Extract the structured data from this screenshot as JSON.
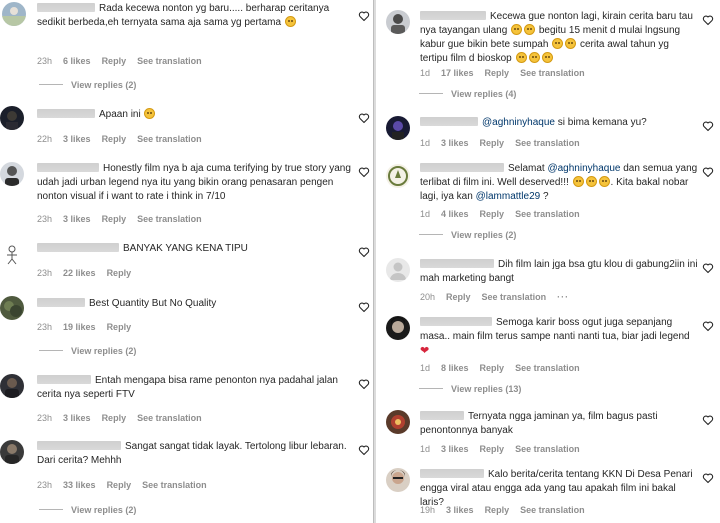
{
  "ui": {
    "reply_label": "Reply",
    "translate_label": "See translation",
    "more_label": "···"
  },
  "left": [
    {
      "name_frag": "...may_tadrat",
      "text": "Rada kecewa nonton yg baru..... berharap ceritanya sedikit berbeda,eh ternyata sama aja sama yg pertama",
      "emoji_end": 1,
      "time": "23h",
      "likes": "6 likes",
      "replies": "View replies (2)"
    },
    {
      "text": "Apaan ini",
      "emoji_end": 1,
      "time": "22h",
      "likes": "3 likes"
    },
    {
      "name_frag": "___",
      "text": "Honestly film nya b aja cuma terifying by true story yang udah jadi urban legend nya itu yang bikin orang penasaran pengen nonton visual if i want to rate i think in 7/10",
      "time": "23h",
      "likes": "3 likes"
    },
    {
      "name_frag": "25",
      "text": "BANYAK YANG KENA TIPU",
      "time": "23h",
      "likes": "22 likes"
    },
    {
      "name_frag": "_",
      "text": "Best Quantity But No Quality",
      "time": "23h",
      "likes": "19 likes",
      "replies": "View replies (2)"
    },
    {
      "text": "Entah mengapa bisa rame penonton nya padahal jalan cerita nya seperti FTV",
      "time": "23h",
      "likes": "3 likes"
    },
    {
      "text": "Sangat sangat tidak layak. Tertolong libur lebaran. Dari cerita? Mehhh",
      "time": "23h",
      "likes": "33 likes",
      "replies": "View replies (2)"
    }
  ],
  "right": [
    {
      "text": "Kecewa gue nonton lagi, kirain cerita baru tau nya tayangan ulang",
      "text2": "begitu 15 menit d mulai lngsung kabur gue bikin bete sumpah",
      "text3": "cerita awal tahun yg tertipu film d bioskop",
      "time": "1d",
      "likes": "17 likes",
      "replies": "View replies (4)"
    },
    {
      "mention": "@aghninyhaque",
      "text": "si bima kemana yu?",
      "time": "1d",
      "likes": "3 likes"
    },
    {
      "text": "Selamat",
      "mention": "@aghninyhaque",
      "text2": "dan semua yang terlibat di film ini. Well deserved!!!",
      "text3": ". Kita bakal nobar lagi, iya kan",
      "mention2": "@lammattle29",
      "text4": "?",
      "time": "1d",
      "likes": "4 likes",
      "replies": "View replies (2)"
    },
    {
      "text": "Dih film lain jga bsa gtu klou di gabung2iin ini mah marketing bangt",
      "time": "20h"
    },
    {
      "text": "Semoga karir boss ogut juga sepanjang masa.. main film terus sampe nanti nanti tua, biar jadi legend",
      "time": "1d",
      "likes": "8 likes",
      "replies": "View replies (13)"
    },
    {
      "text": "Ternyata ngga jaminan ya, film bagus pasti penontonnya banyak",
      "time": "1d",
      "likes": "3 likes"
    },
    {
      "name_frag": "f",
      "text": "Kalo berita/cerita tentang KKN Di Desa Penari engga viral atau engga ada yang tau apakah film ini bakal laris?",
      "time": "19h",
      "likes": "3 likes"
    }
  ]
}
